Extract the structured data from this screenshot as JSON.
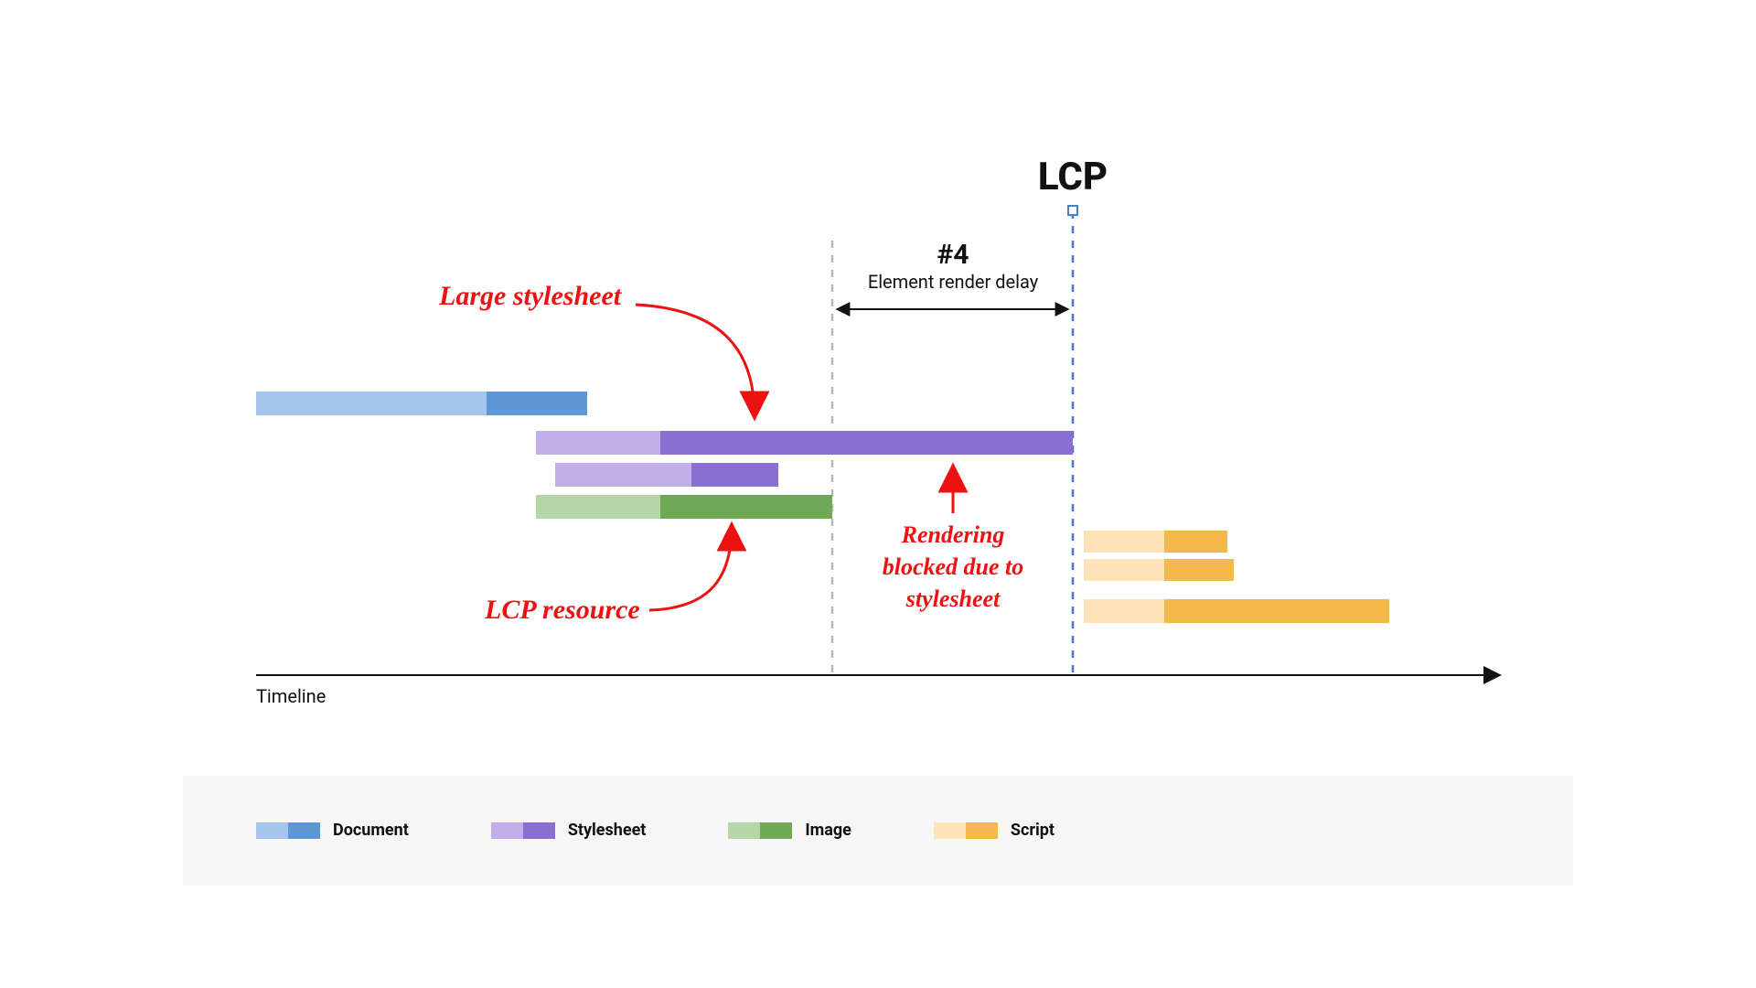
{
  "title": "LCP",
  "segment": {
    "num": "#4",
    "name": "Element render delay"
  },
  "annotations": {
    "large_stylesheet": "Large stylesheet",
    "lcp_resource": "LCP resource",
    "blocked_l1": "Rendering",
    "blocked_l2": "blocked due to",
    "blocked_l3": "stylesheet"
  },
  "axis": "Timeline",
  "legend": {
    "document": "Document",
    "stylesheet": "Stylesheet",
    "image": "Image",
    "script": "Script"
  },
  "colors": {
    "doc_light": "#a4c6ed",
    "doc_dark": "#5e97d6",
    "sty_light": "#c2aee8",
    "sty_dark": "#8a6fd1",
    "img_light": "#b5d6a6",
    "img_dark": "#6fa958",
    "scr_light": "#ffe3b8",
    "scr_dark": "#f3b94c",
    "dash_gray": "#b7b7b7",
    "dash_blue": "#4a7cc0",
    "red": "#e11"
  },
  "chart_data": {
    "type": "bar",
    "note": "Waterfall-style resource timeline; x-values are approximate % of timeline (0-100)",
    "x_range": [
      0,
      100
    ],
    "markers": {
      "gray_dash": 48.5,
      "lcp_dash": 69.0
    },
    "bars": [
      {
        "name": "document",
        "kind": "Document",
        "row": 0,
        "x0": 0.0,
        "split": 18.5,
        "x1": 26.5
      },
      {
        "name": "large-stylesheet",
        "kind": "Stylesheet",
        "row": 1,
        "x0": 22.5,
        "split": 32.5,
        "x1": 69.0
      },
      {
        "name": "stylesheet-2",
        "kind": "Stylesheet",
        "row": 2,
        "x0": 24.0,
        "split": 35.0,
        "x1": 42.0
      },
      {
        "name": "lcp-image",
        "kind": "Image",
        "row": 3,
        "x0": 22.5,
        "split": 32.5,
        "x1": 48.5
      },
      {
        "name": "script-1",
        "kind": "Script",
        "row": 4,
        "x0": 69.5,
        "split": 76.0,
        "x1": 81.0
      },
      {
        "name": "script-2",
        "kind": "Script",
        "row": 5,
        "x0": 69.5,
        "split": 76.0,
        "x1": 81.5
      },
      {
        "name": "script-3",
        "kind": "Script",
        "row": 6,
        "x0": 69.5,
        "split": 76.0,
        "x1": 94.0
      }
    ],
    "segment_span": {
      "from": 48.5,
      "to": 69.0,
      "label": "#4 Element render delay"
    }
  }
}
